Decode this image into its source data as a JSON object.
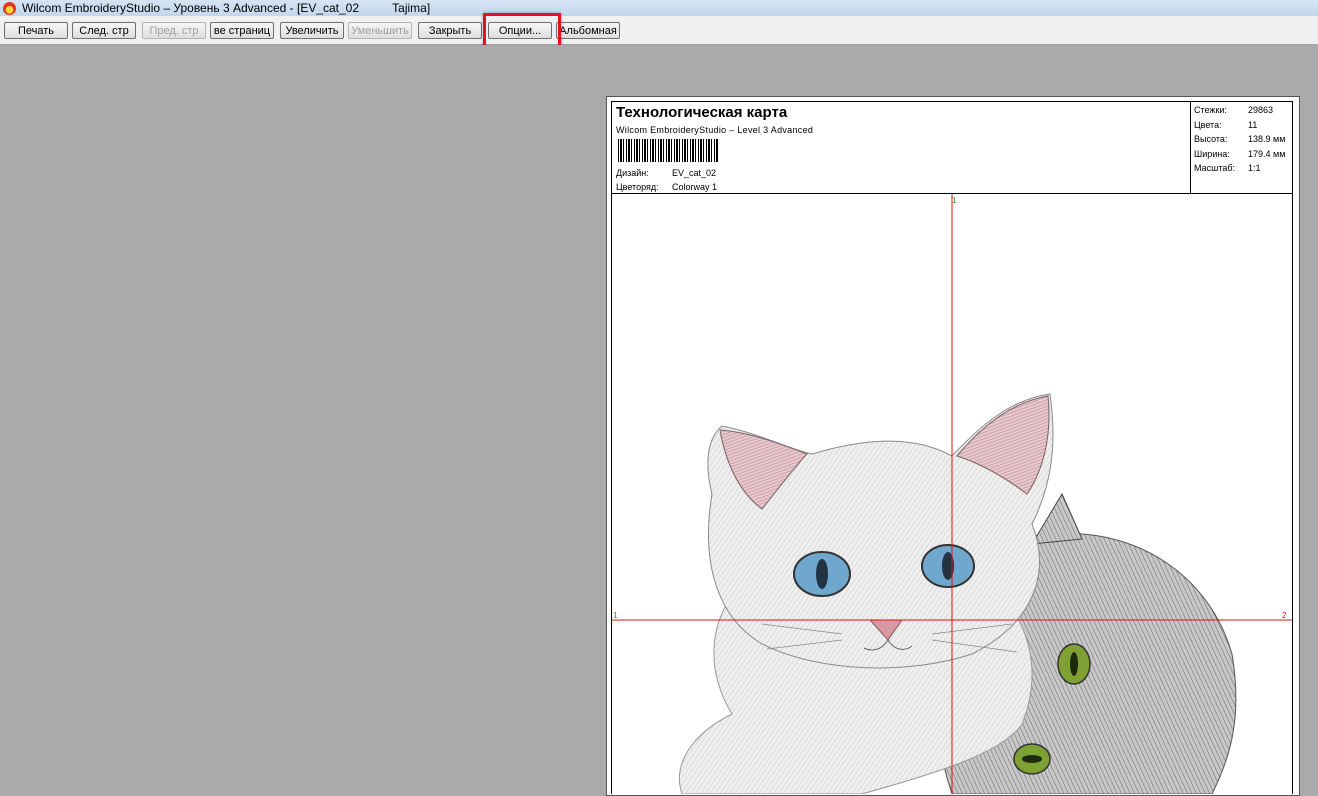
{
  "window": {
    "title": "Wilcom EmbroideryStudio – Уровень 3 Advanced - [EV_cat_02          Tajima]"
  },
  "toolbar": {
    "print": "Печать",
    "next_page": "След. стр",
    "prev_page": "Пред. стр",
    "all_pages": "ве страниц",
    "zoom_in": "Увеличить",
    "zoom_out": "Уменьшить",
    "close": "Закрыть",
    "options": "Опции...",
    "landscape": "Альбомная"
  },
  "worksheet": {
    "title": "Технологическая карта",
    "subtitle": "Wilcom EmbroideryStudio – Level 3 Advanced",
    "design_label": "Дизайн:",
    "design_value": "EV_cat_02",
    "colorway_label": "Цветоряд:",
    "colorway_value": "Colorway 1",
    "stats": {
      "stitches_label": "Стежки:",
      "stitches_value": "29863",
      "colors_label": "Цвета:",
      "colors_value": "11",
      "height_label": "Высота:",
      "height_value": "138.9 мм",
      "width_label": "Ширина:",
      "width_value": "179.4 мм",
      "scale_label": "Масштаб:",
      "scale_value": "1:1"
    },
    "markers": {
      "top": "1",
      "left": "1",
      "right": "2"
    }
  },
  "colors": {
    "highlight": "#e0141e",
    "crosshair": "#e01010",
    "marker_green": "#19a319",
    "marker_red": "#e01010"
  }
}
